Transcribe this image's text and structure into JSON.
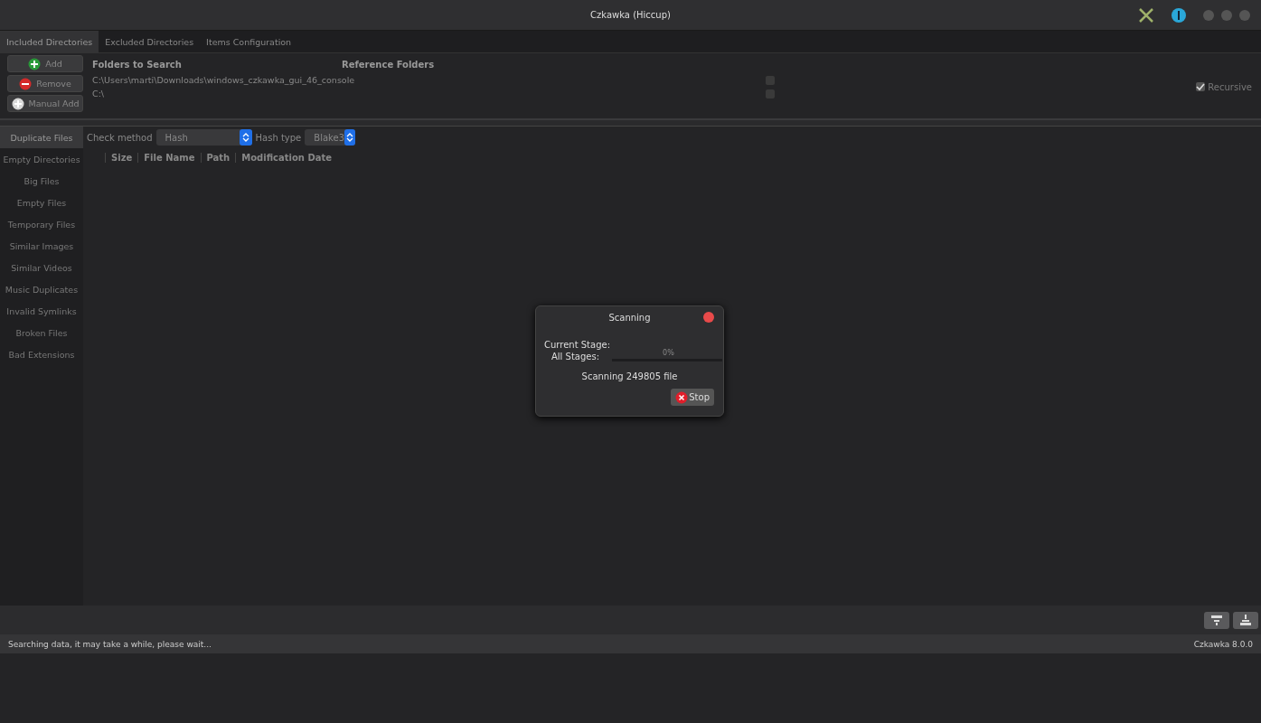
{
  "window": {
    "title": "Czkawka (Hiccup)"
  },
  "tabs": [
    {
      "label": "Included Directories",
      "selected": true
    },
    {
      "label": "Excluded Directories",
      "selected": false
    },
    {
      "label": "Items Configuration",
      "selected": false
    }
  ],
  "dir_buttons": [
    {
      "label": "Add",
      "kind": "add"
    },
    {
      "label": "Remove",
      "kind": "remove"
    },
    {
      "label": "Manual Add",
      "kind": "manual"
    }
  ],
  "folders": {
    "column_1": "Folders to Search",
    "column_2": "Reference Folders",
    "rows": [
      {
        "path": "C:\\Users\\marti\\Downloads\\windows_czkawka_gui_46_console",
        "reference": false
      },
      {
        "path": "C:\\",
        "reference": false
      }
    ]
  },
  "recursive": {
    "label": "Recursive",
    "checked": true
  },
  "sidebar": {
    "items": [
      {
        "label": "Duplicate Files",
        "selected": true
      },
      {
        "label": "Empty Directories",
        "selected": false
      },
      {
        "label": "Big Files",
        "selected": false
      },
      {
        "label": "Empty Files",
        "selected": false
      },
      {
        "label": "Temporary Files",
        "selected": false
      },
      {
        "label": "Similar Images",
        "selected": false
      },
      {
        "label": "Similar Videos",
        "selected": false
      },
      {
        "label": "Music Duplicates",
        "selected": false
      },
      {
        "label": "Invalid Symlinks",
        "selected": false
      },
      {
        "label": "Broken Files",
        "selected": false
      },
      {
        "label": "Bad Extensions",
        "selected": false
      }
    ]
  },
  "options": [
    {
      "label": "Check method",
      "value": "Hash"
    },
    {
      "label": "Hash type",
      "value": "Blake3"
    }
  ],
  "table": {
    "columns": [
      "Size",
      "File Name",
      "Path",
      "Modification Date"
    ]
  },
  "dialog": {
    "title": "Scanning",
    "current_stage_label": "Current Stage:",
    "all_stages_label": "All Stages:",
    "all_stages_reading": "0%",
    "level": 0,
    "message": "Scanning 249805 file",
    "button": "Stop"
  },
  "status_bar": {
    "message": "Searching data, it may take a while, please wait...",
    "version": "Czkawka 8.0.0"
  }
}
